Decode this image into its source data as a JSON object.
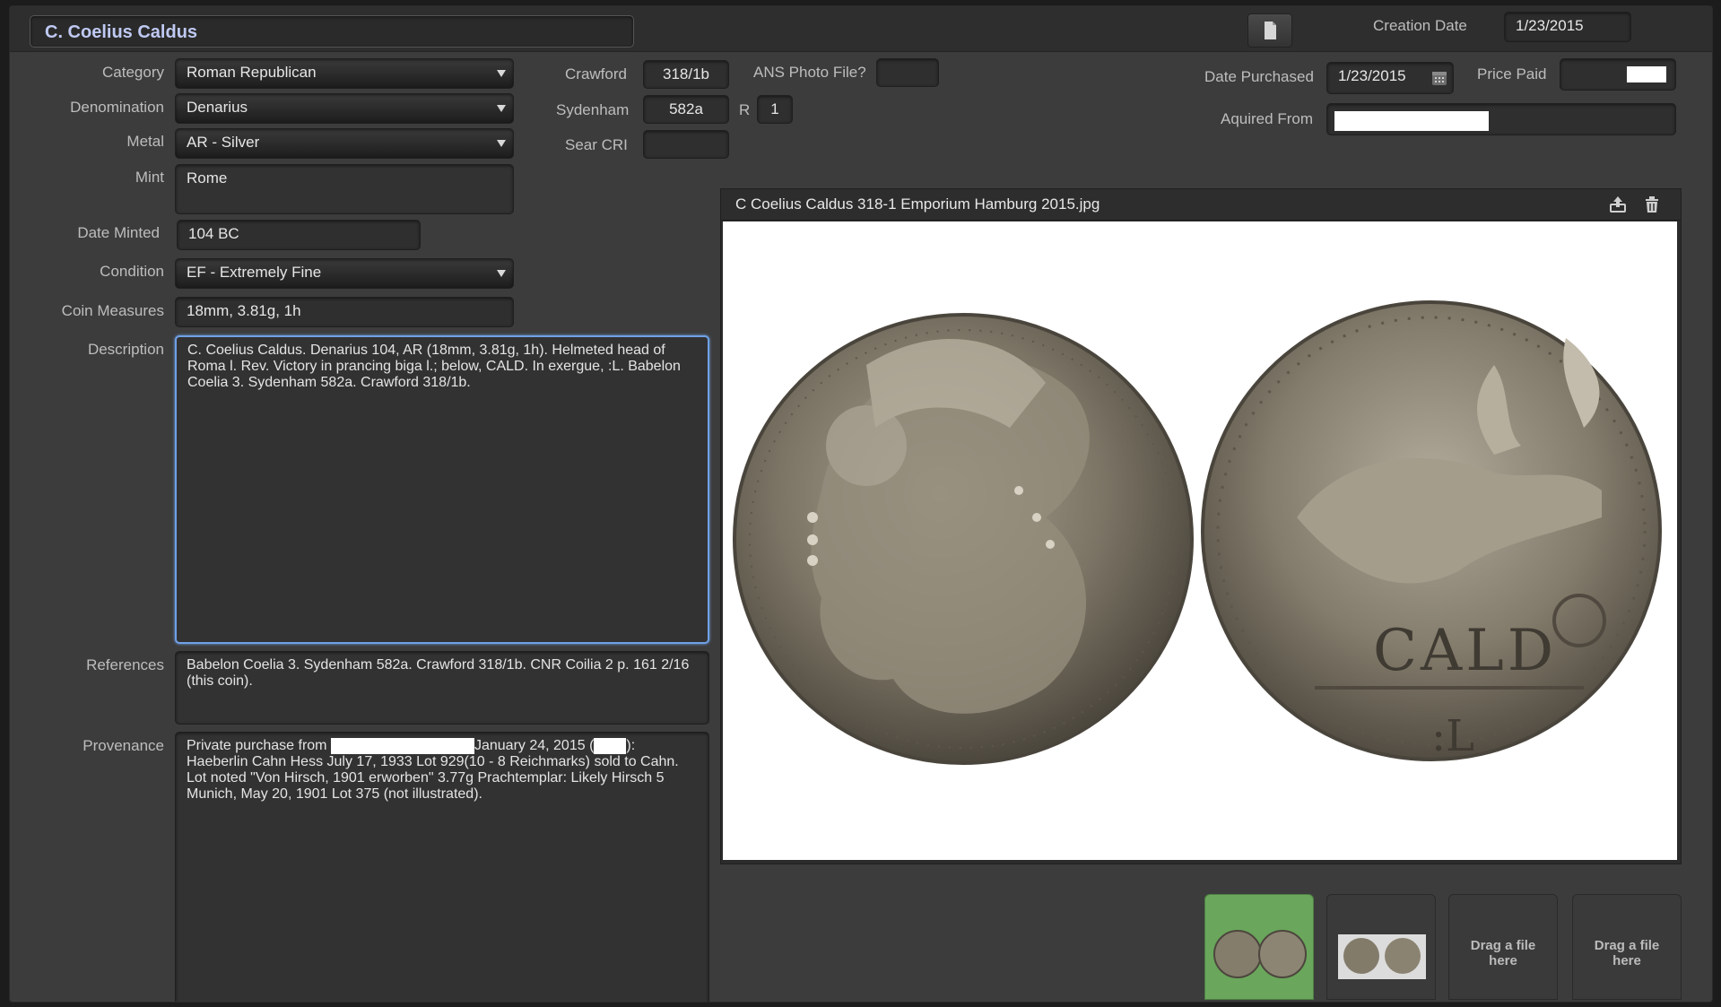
{
  "title": "C. Coelius Caldus",
  "header": {
    "creation_date_label": "Creation Date",
    "creation_date_value": "1/23/2015"
  },
  "fields": {
    "category_label": "Category",
    "category_value": "Roman Republican",
    "denomination_label": "Denomination",
    "denomination_value": "Denarius",
    "metal_label": "Metal",
    "metal_value": "AR - Silver",
    "mint_label": "Mint",
    "mint_value": "Rome",
    "date_minted_label": "Date Minted",
    "date_minted_value": "104 BC",
    "condition_label": "Condition",
    "condition_value": "EF - Extremely Fine",
    "coin_measures_label": "Coin Measures",
    "coin_measures_value": "18mm, 3.81g, 1h",
    "description_label": "Description",
    "description_value": "C. Coelius Caldus. Denarius 104, AR (18mm, 3.81g, 1h). Helmeted head of Roma l. Rev. Victory in prancing biga l.; below, CALD. In exergue, :L. Babelon Coelia 3. Sydenham 582a. Crawford 318/1b.",
    "references_label": "References",
    "references_value": "Babelon Coelia 3. Sydenham 582a. Crawford 318/1b. CNR Coilia 2 p. 161 2/16 (this coin).",
    "provenance_label": "Provenance",
    "provenance_part1": "Private purchase from",
    "provenance_part2": "January 24, 2015 (",
    "provenance_part3": "): Haeberlin Cahn Hess July 17, 1933 Lot 929(10 - 8 Reichmarks) sold to Cahn.  Lot noted \"Von Hirsch, 1901 erworben\" 3.77g Prachtemplar: Likely Hirsch 5 Munich, May 20, 1901 Lot 375 (not illustrated)."
  },
  "refs": {
    "crawford_label": "Crawford",
    "crawford_value": "318/1b",
    "ans_label": "ANS Photo File?",
    "sydenham_label": "Sydenham",
    "sydenham_value": "582a",
    "rarity_label": "R",
    "rarity_value": "1",
    "sear_label": "Sear CRI"
  },
  "purchase": {
    "date_purchased_label": "Date Purchased",
    "date_purchased_value": "1/23/2015",
    "price_paid_label": "Price Paid",
    "acquired_from_label": "Aquired From"
  },
  "image_panel": {
    "filename": "C Coelius Caldus 318-1 Emporium Hamburg 2015.jpg",
    "reverse_legend": "CALD",
    "exergue": ":L"
  },
  "thumbnails": {
    "drop_label_1": "Drag a file here",
    "drop_label_2": "Drag a file here"
  },
  "colors": {
    "title_text": "#bfc9f2",
    "focus_ring": "#6fa1e6",
    "selected_thumb": "#6aa65c"
  }
}
